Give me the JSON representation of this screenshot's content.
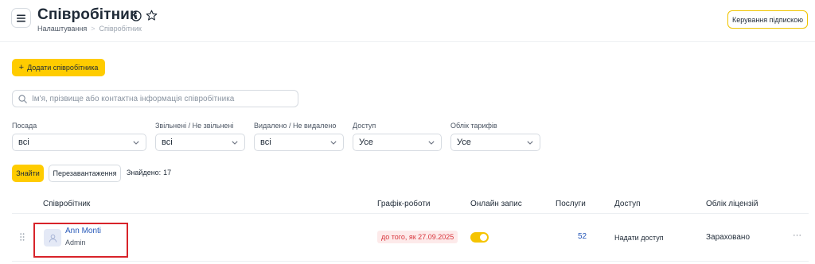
{
  "header": {
    "title": "Співробітник",
    "breadcrumb": {
      "parent": "Налаштування",
      "separator": ">",
      "current": "Співробітник"
    },
    "subscription_button": "Керування підпискою"
  },
  "actions": {
    "add_employee": "Додати співробітника",
    "add_icon": "+"
  },
  "search": {
    "placeholder": "Ім'я, прізвище або контактна інформація співробітника",
    "value": ""
  },
  "filters": [
    {
      "label": "Посада",
      "value": "всі"
    },
    {
      "label": "Звільнені / Не звільнені",
      "value": "всі"
    },
    {
      "label": "Видалено / Не видалено",
      "value": "всі"
    },
    {
      "label": "Доступ",
      "value": "Усе"
    },
    {
      "label": "Облік тарифів",
      "value": "Усе"
    }
  ],
  "toolbar": {
    "find": "Знайти",
    "reload": "Перезавантаження",
    "found_label": "Знайдено:",
    "found_count": "17"
  },
  "table": {
    "columns": [
      "Співробітник",
      "Графік-роботи",
      "Онлайн запис",
      "Послуги",
      "Доступ",
      "Облік ліцензій"
    ],
    "rows": [
      {
        "name": "Ann Monti",
        "role": "Admin",
        "schedule": "до того, як 27.09.2025",
        "online_booking": true,
        "services": "52",
        "access": "Надати доступ",
        "license": "Зараховано",
        "more": "···"
      }
    ]
  },
  "colors": {
    "accent": "#ffcc00",
    "link": "#2557b8",
    "danger": "#d8363d",
    "highlight_border": "#d8232a"
  },
  "icons": [
    "menu-icon",
    "info-icon",
    "star-icon",
    "plus-icon",
    "search-icon",
    "chevron-down-icon",
    "drag-handle-icon",
    "user-avatar-icon",
    "more-icon"
  ]
}
